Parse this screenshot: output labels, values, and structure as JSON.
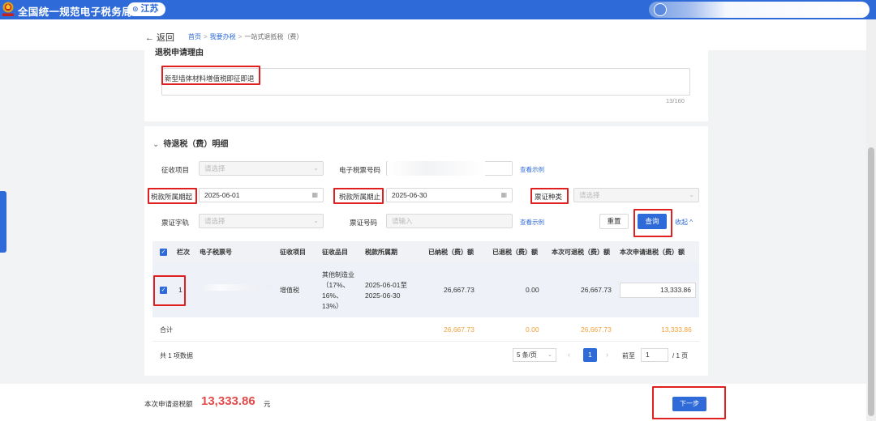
{
  "header": {
    "title": "全国统一规范电子税务局",
    "region": "江苏"
  },
  "breadcrumb": {
    "back": "← 返回",
    "home": "首页",
    "mytax": "我要办税",
    "current": "一站式退抵税（费）"
  },
  "reason": {
    "title": "退税申请理由",
    "text": "新型墙体材料增值税即征即退",
    "counter": "13/160"
  },
  "detail": {
    "title": "待退税（费）明细",
    "filters": {
      "levy_item_label": "征收项目",
      "levy_item_placeholder": "请选择",
      "ticket_no_label": "电子税票号码",
      "example_link": "查看示例",
      "period_start_label": "税款所属期起",
      "period_start_value": "2025-06-01",
      "period_end_label": "税款所属期止",
      "period_end_value": "2025-06-30",
      "voucher_type_label": "票证种类",
      "voucher_type_placeholder": "请选择",
      "voucher_word_label": "票证字轨",
      "voucher_word_placeholder": "请选择",
      "voucher_no_label": "票证号码",
      "voucher_no_placeholder": "请输入",
      "example_link2": "查看示例",
      "reset": "重置",
      "query": "查询",
      "collapse": "收起 ^"
    },
    "table": {
      "headers": [
        "栏次",
        "电子税票号",
        "征收项目",
        "征收品目",
        "税款所属期",
        "已纳税（费）额",
        "已退税（费）额",
        "本次可退税（费）额",
        "本次申请退税（费）额"
      ],
      "rows": [
        {
          "index": "1",
          "levy_item": "增值税",
          "levy_sub_1": "其他制造业",
          "levy_sub_2": "（17%、",
          "levy_sub_3": "16%、",
          "levy_sub_4": "13%）",
          "period_1": "2025-06-01至",
          "period_2": "2025-06-30",
          "paid": "26,667.73",
          "refunded": "0.00",
          "refundable": "26,667.73",
          "apply": "13,333.86"
        }
      ],
      "total": {
        "label": "合计",
        "paid": "26,667.73",
        "refunded": "0.00",
        "refundable": "26,667.73",
        "apply": "13,333.86"
      }
    },
    "pagination": {
      "total": "共 1 项数据",
      "page_size": "5 条/页",
      "current_page": "1",
      "jump_label": "前至",
      "jump_value": "1",
      "of_pages": "/ 1 页"
    }
  },
  "footer": {
    "sum_label": "本次申请退税额",
    "sum_value": "13,333.86",
    "sum_unit": "元",
    "next": "下一步"
  },
  "colors": {
    "primary": "#2f6bd8",
    "highlight": "#e02020",
    "amount": "#e34a4a",
    "total": "#f2a23c"
  }
}
